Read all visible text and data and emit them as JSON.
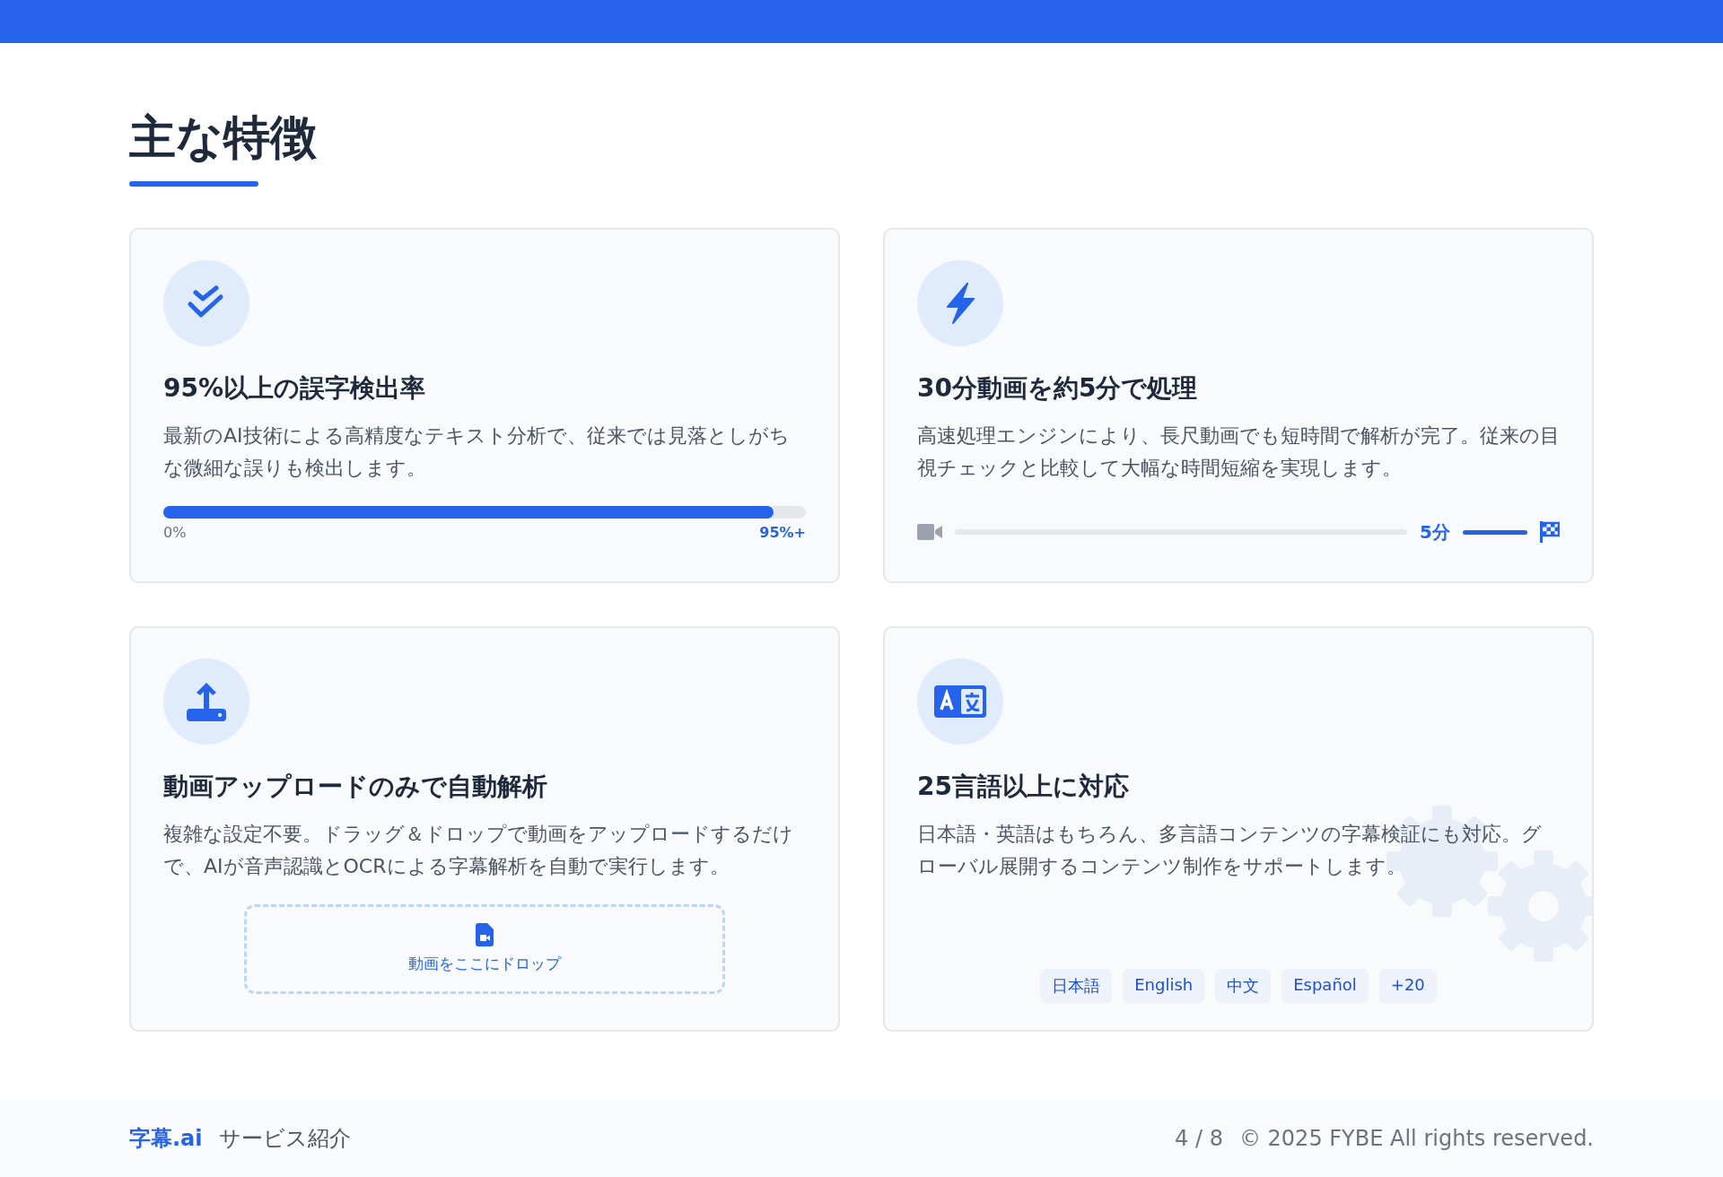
{
  "page_title": "主な特徴",
  "features": [
    {
      "kind": "progress",
      "title": "95%以上の誤字検出率",
      "description": "最新のAI技術による高精度なテキスト分析で、従来では見落としがちな微細な誤りも検出します。",
      "progress": {
        "level": 0.95,
        "start_label": "0%",
        "end_label": "95%+"
      }
    },
    {
      "kind": "timeline",
      "title": "30分動画を約5分で処理",
      "description": "高速処理エンジンにより、長尺動画でも短時間で解析が完了。従来の目視チェックと比較して大幅な時間短縮を実現します。",
      "timeline": {
        "label": "5分"
      }
    },
    {
      "kind": "dropzone",
      "title": "動画アップロードのみで自動解析",
      "description": "複雑な設定不要。ドラッグ＆ドロップで動画をアップロードするだけで、AIが音声認識とOCRによる字幕解析を自動で実行します。",
      "dropzone": {
        "label": "動画をここにドロップ"
      }
    },
    {
      "kind": "languages",
      "title": "25言語以上に対応",
      "description": "日本語・英語はもちろん、多言語コンテンツの字幕検証にも対応。グローバル展開するコンテンツ制作をサポートします。",
      "tags": [
        "日本語",
        "English",
        "中文",
        "Español",
        "+20"
      ]
    }
  ],
  "footer": {
    "brand": "字幕.ai",
    "subtitle": "サービス紹介",
    "page": "4 / 8",
    "copyright": "© 2025 FYBE All rights reserved."
  }
}
